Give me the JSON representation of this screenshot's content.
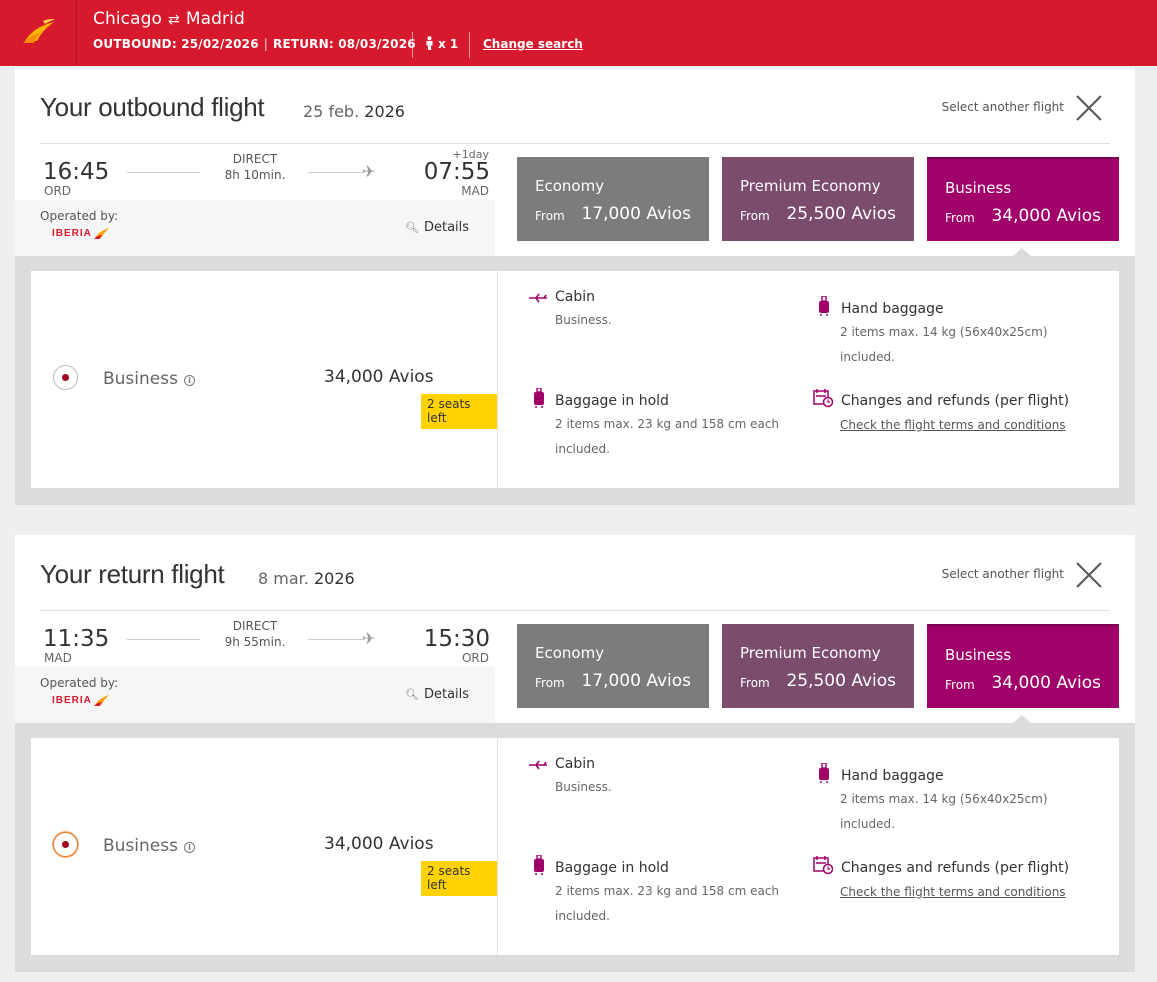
{
  "header": {
    "origin": "Chicago",
    "destination": "Madrid",
    "swap_icon": "⇄",
    "outbound": "OUTBOUND: 25/02/2026",
    "return": "RETURN: 08/03/2026",
    "passengers": "x 1",
    "change_search": "Change search",
    "colors": {
      "brand": "#d7192d"
    }
  },
  "flights": [
    {
      "title": "Your outbound flight",
      "date_day": "25 feb.",
      "date_year": "2026",
      "select_another": "Select another flight",
      "dep_time": "16:45",
      "dep_code": "ORD",
      "arr_time": "07:55",
      "arr_code": "MAD",
      "plus_day": "+1day",
      "direct": "DIRECT",
      "duration": "8h 10min.",
      "operated_by": "Operated by:",
      "airline": "IBERIA",
      "details": "Details",
      "fares": [
        {
          "name": "Economy",
          "from": "From",
          "price": "17,000 Avios"
        },
        {
          "name": "Premium Economy",
          "from": "From",
          "price": "25,500 Avios"
        },
        {
          "name": "Business",
          "from": "From",
          "price": "34,000 Avios"
        }
      ],
      "selected": {
        "name": "Business",
        "price": "34,000 Avios",
        "seats_left": "2 seats left"
      },
      "features": {
        "cabin_title": "Cabin",
        "cabin_text": "Business.",
        "hand_title": "Hand baggage",
        "hand_text1": "2 items max. 14 kg (56x40x25cm)",
        "hand_text2": "included.",
        "hold_title": "Baggage in hold",
        "hold_text1": "2 items max. 23 kg and 158 cm each",
        "hold_text2": "included.",
        "changes_title": "Changes and refunds (per flight)",
        "changes_link": "Check the flight terms and conditions"
      }
    },
    {
      "title": "Your return flight",
      "date_day": "8 mar.",
      "date_year": "2026",
      "select_another": "Select another flight",
      "dep_time": "11:35",
      "dep_code": "MAD",
      "arr_time": "15:30",
      "arr_code": "ORD",
      "plus_day": "",
      "direct": "DIRECT",
      "duration": "9h 55min.",
      "operated_by": "Operated by:",
      "airline": "IBERIA",
      "details": "Details",
      "fares": [
        {
          "name": "Economy",
          "from": "From",
          "price": "17,000 Avios"
        },
        {
          "name": "Premium Economy",
          "from": "From",
          "price": "25,500 Avios"
        },
        {
          "name": "Business",
          "from": "From",
          "price": "34,000 Avios"
        }
      ],
      "selected": {
        "name": "Business",
        "price": "34,000 Avios",
        "seats_left": "2 seats left"
      },
      "features": {
        "cabin_title": "Cabin",
        "cabin_text": "Business.",
        "hand_title": "Hand baggage",
        "hand_text1": "2 items max. 14 kg (56x40x25cm)",
        "hand_text2": "included.",
        "hold_title": "Baggage in hold",
        "hold_text1": "2 items max. 23 kg and 158 cm each",
        "hold_text2": "included.",
        "changes_title": "Changes and refunds (per flight)",
        "changes_link": "Check the flight terms and conditions"
      }
    }
  ]
}
